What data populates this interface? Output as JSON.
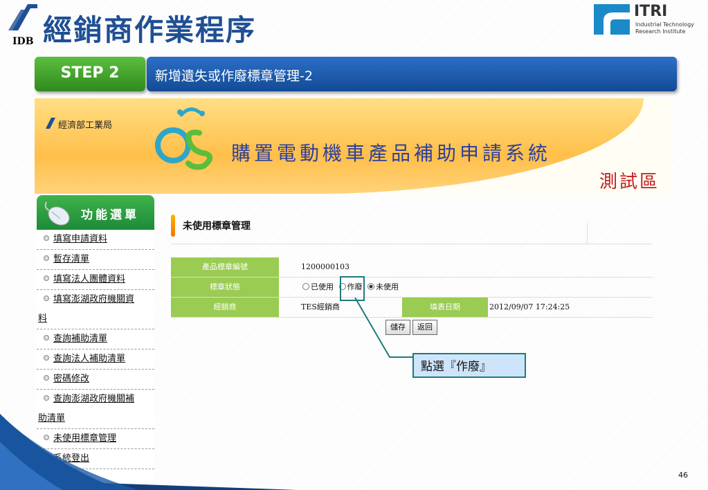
{
  "header": {
    "logo_text": "IDB",
    "title": "經銷商作業程序",
    "itri_word": "ITRI",
    "itri_sub1": "Industrial Technology",
    "itri_sub2": "Research Institute"
  },
  "step": {
    "badge": "STEP 2",
    "title": "新增遺失或作廢標章管理-2"
  },
  "banner": {
    "agency": "經濟部工業局",
    "system_name": "購置電動機車產品補助申請系統",
    "test_area": "測試區"
  },
  "sidebar": {
    "heading": "功能選單",
    "items": [
      {
        "label": "填寫申請資料"
      },
      {
        "label": "暫存清單"
      },
      {
        "label": "填寫法人團體資料"
      },
      {
        "label": "填寫澎湖政府機關資",
        "label2": "料"
      },
      {
        "label": "查詢補助清單"
      },
      {
        "label": "查詢法人補助清單"
      },
      {
        "label": "密碼修改"
      },
      {
        "label": "查詢澎湖政府機關補",
        "label2": "助清單"
      },
      {
        "label": "未使用標章管理"
      },
      {
        "label": "系統登出"
      }
    ]
  },
  "main": {
    "title": "未使用標章管理",
    "fields": {
      "label_number": "產品標章編號",
      "value_number": "1200000103",
      "label_status": "標章狀態",
      "opt_used": "已使用",
      "opt_void": "作廢",
      "opt_unused": "未使用",
      "label_dealer": "經銷商",
      "value_dealer": "TES經銷商",
      "label_date": "填表日期",
      "value_date": "2012/09/07 17:24:25"
    },
    "buttons": {
      "save": "儲存",
      "back": "返回"
    }
  },
  "callout": {
    "text": "點選『作廢』"
  },
  "page_number": "46",
  "colors": {
    "title_blue": "#1f4f95",
    "step_green": "#3a9a2a",
    "step_blue": "#1a5aac",
    "field_green": "#9acb52",
    "callout_border": "#1e7a7a"
  }
}
